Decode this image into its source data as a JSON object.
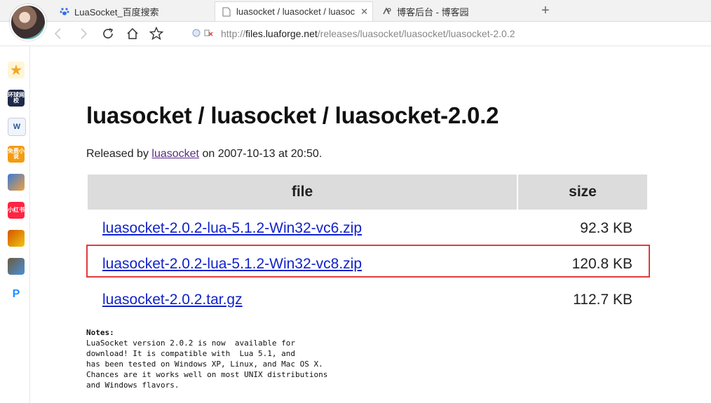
{
  "tabs": [
    {
      "label": "LuaSocket_百度搜索",
      "icon": "baidu-paw-icon",
      "active": false
    },
    {
      "label": "luasocket / luasocket / luasoc",
      "icon": "page-icon",
      "active": true,
      "close": "✕"
    },
    {
      "label": "博客后台 - 博客园",
      "icon": "cnblogs-icon",
      "active": false
    }
  ],
  "new_tab": "+",
  "address": {
    "scheme": "http://",
    "host": "files.luaforge.net",
    "path": "/releases/luasocket/luasocket/luasocket-2.0.2"
  },
  "page": {
    "title": "luasocket / luasocket / luasocket-2.0.2",
    "released_prefix": "Released by",
    "released_by": "luasocket",
    "released_suffix": "on 2007-10-13 at 20:50.",
    "table": {
      "headers": [
        "file",
        "size"
      ],
      "rows": [
        {
          "file": "luasocket-2.0.2-lua-5.1.2-Win32-vc6.zip",
          "size": "92.3 KB"
        },
        {
          "file": "luasocket-2.0.2-lua-5.1.2-Win32-vc8.zip",
          "size": "120.8 KB"
        },
        {
          "file": "luasocket-2.0.2.tar.gz",
          "size": "112.7 KB"
        }
      ]
    },
    "notes_heading": "Notes:",
    "notes_lines": [
      "LuaSocket version 2.0.2 is now  available for",
      "download! It is compatible with  Lua 5.1, and",
      "has been tested on Windows XP, Linux, and Mac OS X.",
      "Chances are it works well on most UNIX distributions",
      "and Windows flavors."
    ]
  },
  "sidebar": {
    "items": [
      {
        "name": "favorites-icon",
        "text": "★",
        "color": "#f5a623"
      },
      {
        "name": "huanqiu-app-icon",
        "text": "环球网校",
        "color": "#1e2a4a"
      },
      {
        "name": "word-doc-icon",
        "text": "W",
        "color": "#2b579a"
      },
      {
        "name": "free-novel-icon",
        "text": "免费小说",
        "color": "#f39c12"
      },
      {
        "name": "game-app-icon-1",
        "text": "",
        "color": "#3a7bd5"
      },
      {
        "name": "xiaohongshu-icon",
        "text": "小红书",
        "color": "#ff2442"
      },
      {
        "name": "game-app-icon-2",
        "text": "",
        "color": "#d35400"
      },
      {
        "name": "game-app-icon-3",
        "text": "",
        "color": "#6b5b3e"
      },
      {
        "name": "p-logo-icon",
        "text": "P",
        "color": "#1e90ff"
      }
    ]
  },
  "colors": {
    "highlight_border": "#e03c3c",
    "link": "#1122cc",
    "visited_link": "#5a2d82",
    "header_bg": "#dcdcdc"
  }
}
